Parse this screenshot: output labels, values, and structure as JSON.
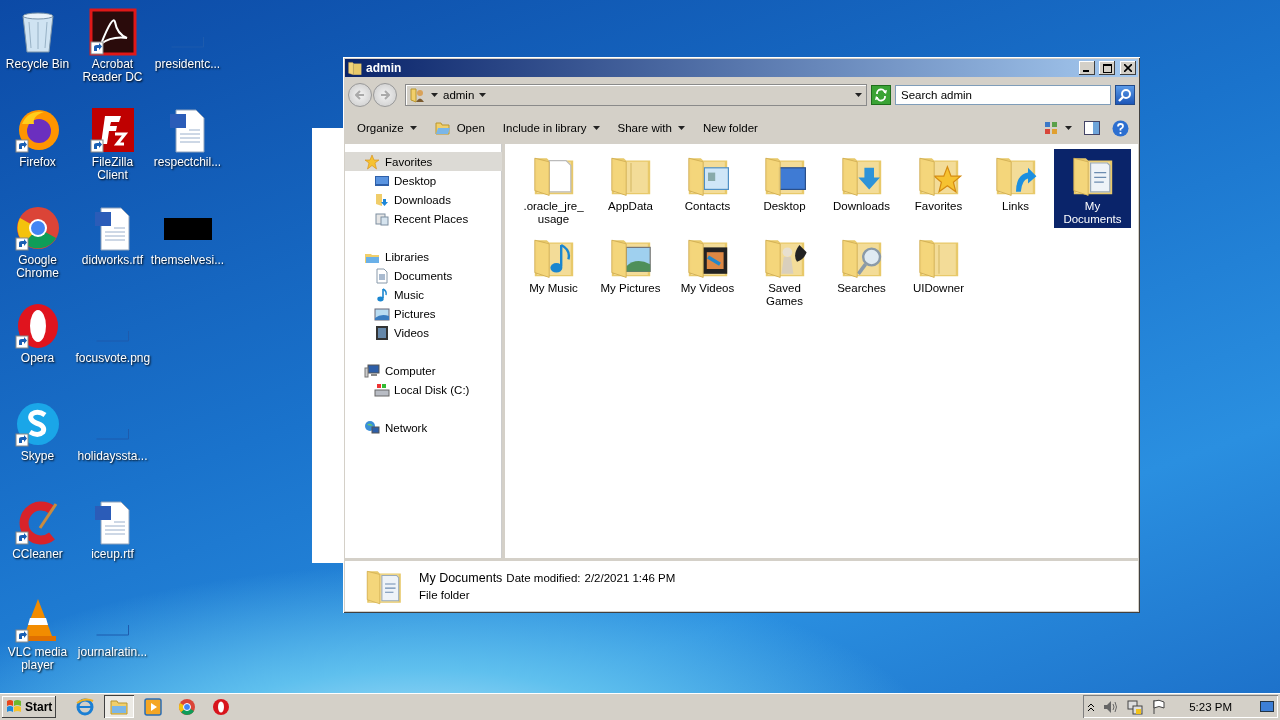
{
  "desktop": {
    "columns": [
      [
        {
          "label": "Recycle Bin",
          "kind": "bin",
          "shortcut": false
        },
        {
          "label": "Firefox",
          "kind": "firefox",
          "shortcut": true
        },
        {
          "label": "Google Chrome",
          "kind": "chrome",
          "shortcut": true
        },
        {
          "label": "Opera",
          "kind": "opera",
          "shortcut": true
        },
        {
          "label": "Skype",
          "kind": "skype",
          "shortcut": true
        },
        {
          "label": "CCleaner",
          "kind": "ccleaner",
          "shortcut": true
        },
        {
          "label": "VLC media player",
          "kind": "vlc",
          "shortcut": true
        }
      ],
      [
        {
          "label": "Acrobat Reader DC",
          "kind": "acrobat",
          "shortcut": true
        },
        {
          "label": "FileZilla Client",
          "kind": "filezilla",
          "shortcut": true
        },
        {
          "label": "didworks.rtf",
          "kind": "doc",
          "shortcut": false
        },
        {
          "label": "focusvote.png",
          "kind": "blank",
          "shortcut": false
        },
        {
          "label": "holidayssta...",
          "kind": "blank",
          "shortcut": false
        },
        {
          "label": "iceup.rtf",
          "kind": "doc",
          "shortcut": false
        },
        {
          "label": "journalratin...",
          "kind": "blank",
          "shortcut": false
        }
      ],
      [
        {
          "label": "presidentc...",
          "kind": "blank",
          "shortcut": false
        },
        {
          "label": "respectchil...",
          "kind": "doc",
          "shortcut": false
        },
        {
          "label": "themselvesi...",
          "kind": "black",
          "shortcut": false
        }
      ]
    ]
  },
  "window": {
    "title": "admin",
    "address": {
      "path": "admin"
    },
    "search": {
      "placeholder": "Search admin"
    },
    "toolbar": [
      {
        "label": "Organize",
        "kind": "menu"
      },
      {
        "label": "Open",
        "kind": "icon"
      },
      {
        "label": "Include in library",
        "kind": "menu"
      },
      {
        "label": "Share with",
        "kind": "menu"
      },
      {
        "label": "New folder",
        "kind": "plain"
      }
    ],
    "nav": [
      {
        "label": "Favorites",
        "kind": "star",
        "selected": true,
        "children": [
          {
            "label": "Desktop",
            "kind": "desktop",
            "selected": false
          },
          {
            "label": "Downloads",
            "kind": "downloads",
            "selected": false
          },
          {
            "label": "Recent Places",
            "kind": "recent",
            "selected": false
          }
        ]
      },
      {
        "label": "Libraries",
        "kind": "library",
        "selected": false,
        "children": [
          {
            "label": "Documents",
            "kind": "documents",
            "selected": false
          },
          {
            "label": "Music",
            "kind": "music",
            "selected": false
          },
          {
            "label": "Pictures",
            "kind": "pictures",
            "selected": false
          },
          {
            "label": "Videos",
            "kind": "videos",
            "selected": false
          }
        ]
      },
      {
        "label": "Computer",
        "kind": "computer",
        "selected": false,
        "children": [
          {
            "label": "Local Disk (C:)",
            "kind": "disk",
            "selected": false
          }
        ]
      },
      {
        "label": "Network",
        "kind": "network",
        "selected": false
      }
    ],
    "folders": [
      {
        "label": ".oracle_jre_usage",
        "kind": "page",
        "selected": false
      },
      {
        "label": "AppData",
        "kind": "plain",
        "selected": false
      },
      {
        "label": "Contacts",
        "kind": "contacts",
        "selected": false
      },
      {
        "label": "Desktop",
        "kind": "desktop",
        "selected": false
      },
      {
        "label": "Downloads",
        "kind": "downloads",
        "selected": false
      },
      {
        "label": "Favorites",
        "kind": "star",
        "selected": false
      },
      {
        "label": "Links",
        "kind": "links",
        "selected": false
      },
      {
        "label": "My Documents",
        "kind": "documents",
        "selected": true
      },
      {
        "label": "My Music",
        "kind": "music",
        "selected": false
      },
      {
        "label": "My Pictures",
        "kind": "pictures",
        "selected": false
      },
      {
        "label": "My Videos",
        "kind": "videos",
        "selected": false
      },
      {
        "label": "Saved Games",
        "kind": "games",
        "selected": false
      },
      {
        "label": "Searches",
        "kind": "searches",
        "selected": false
      },
      {
        "label": "UIDowner",
        "kind": "plain",
        "selected": false
      }
    ],
    "details": {
      "name": "My Documents",
      "date_label": "Date modified:",
      "date": "2/2/2021 1:46 PM",
      "type": "File folder"
    }
  },
  "taskbar": {
    "start": "Start",
    "apps": [
      {
        "kind": "ie",
        "active": false
      },
      {
        "kind": "explorer",
        "active": true
      },
      {
        "kind": "media",
        "active": false
      },
      {
        "kind": "chrome",
        "active": false
      },
      {
        "kind": "opera",
        "active": false
      }
    ],
    "time": "5:23 PM"
  }
}
